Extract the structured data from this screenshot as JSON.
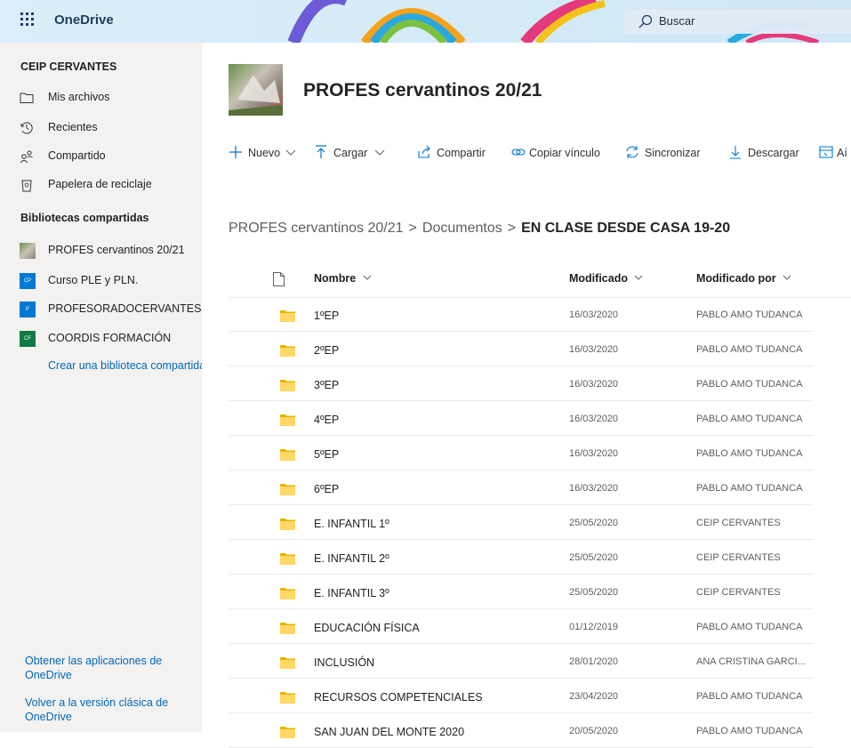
{
  "app": {
    "name": "OneDrive"
  },
  "search": {
    "placeholder": "Buscar"
  },
  "sidebar": {
    "org": "CEIP CERVANTES",
    "nav": [
      {
        "label": "Mis archivos",
        "icon": "folder-icon"
      },
      {
        "label": "Recientes",
        "icon": "clock-icon"
      },
      {
        "label": "Compartido",
        "icon": "people-icon"
      },
      {
        "label": "Papelera de reciclaje",
        "icon": "recycle-bin-icon"
      }
    ],
    "libraries_heading": "Bibliotecas compartidas",
    "libraries": [
      {
        "label": "PROFES cervantinos 20/21",
        "tile": "",
        "color": "#7a8f5c"
      },
      {
        "label": "Curso PLE y PLN.",
        "tile": "CP",
        "color": "#0078d4"
      },
      {
        "label": "PROFESORADOCERVANTES",
        "tile": "P",
        "color": "#0078d4"
      },
      {
        "label": "COORDIS FORMACIÓN",
        "tile": "CF",
        "color": "#107c41"
      }
    ],
    "create_library": "Crear una biblioteca compartida",
    "footer_links": [
      "Obtener las aplicaciones de OneDrive",
      "Volver a la versión clásica de OneDrive"
    ]
  },
  "site": {
    "title": "PROFES cervantinos 20/21"
  },
  "commands": [
    {
      "label": "Nuevo",
      "icon": "plus-icon",
      "chevron": true
    },
    {
      "label": "Cargar",
      "icon": "upload-icon",
      "chevron": true
    },
    {
      "label": "Compartir",
      "icon": "share-icon",
      "chevron": false
    },
    {
      "label": "Copiar vínculo",
      "icon": "link-icon",
      "chevron": false
    },
    {
      "label": "Sincronizar",
      "icon": "sync-icon",
      "chevron": false
    },
    {
      "label": "Descargar",
      "icon": "download-icon",
      "chevron": false
    },
    {
      "label": "Aí",
      "icon": "add-shortcut-icon",
      "chevron": false
    }
  ],
  "breadcrumb": [
    "PROFES cervantinos 20/21",
    "Documentos",
    "EN CLASE DESDE CASA 19-20"
  ],
  "table": {
    "columns": {
      "name": "Nombre",
      "modified": "Modificado",
      "modified_by": "Modificado por"
    },
    "rows": [
      {
        "name": "1ºEP",
        "modified": "16/03/2020",
        "by": "PABLO AMO TUDANCA"
      },
      {
        "name": "2ºEP",
        "modified": "16/03/2020",
        "by": "PABLO AMO TUDANCA"
      },
      {
        "name": "3ºEP",
        "modified": "16/03/2020",
        "by": "PABLO AMO TUDANCA"
      },
      {
        "name": "4ºEP",
        "modified": "16/03/2020",
        "by": "PABLO AMO TUDANCA"
      },
      {
        "name": "5ºEP",
        "modified": "16/03/2020",
        "by": "PABLO AMO TUDANCA"
      },
      {
        "name": "6ºEP",
        "modified": "16/03/2020",
        "by": "PABLO AMO TUDANCA"
      },
      {
        "name": "E. INFANTIL 1º",
        "modified": "25/05/2020",
        "by": "CEIP CERVANTES"
      },
      {
        "name": "E. INFANTIL 2º",
        "modified": "25/05/2020",
        "by": "CEIP CERVANTES"
      },
      {
        "name": "E. INFANTIL 3º",
        "modified": "25/05/2020",
        "by": "CEIP CERVANTES"
      },
      {
        "name": "EDUCACIÓN FÍSICA",
        "modified": "01/12/2019",
        "by": "PABLO AMO TUDANCA"
      },
      {
        "name": "INCLUSIÓN",
        "modified": "28/01/2020",
        "by": "ANA CRISTINA GARCI..."
      },
      {
        "name": "RECURSOS COMPETENCIALES",
        "modified": "23/04/2020",
        "by": "PABLO AMO TUDANCA"
      },
      {
        "name": "SAN JUAN DEL MONTE 2020",
        "modified": "20/05/2020",
        "by": "PABLO AMO TUDANCA"
      }
    ]
  },
  "colors": {
    "accent": "#0078d4",
    "folder": "#ffd865",
    "sidebar_bg": "#f3f2f1"
  }
}
